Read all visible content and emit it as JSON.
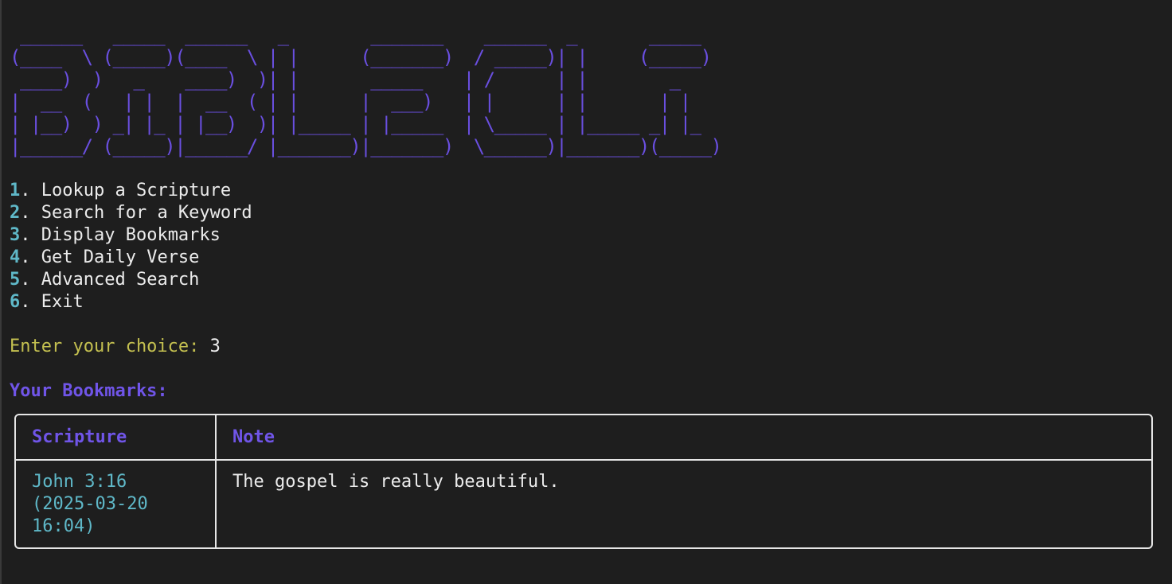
{
  "colors": {
    "background": "#1e1e1e",
    "banner": "#6a4fe0",
    "menu_number": "#5fb8c8",
    "text": "#ececec",
    "prompt": "#c4c050",
    "heading": "#7055e8",
    "scripture": "#5fb8c8",
    "border": "#e6e6e6"
  },
  "banner_lines": [
    " ______   _____  ______   _        _______    ______  _       _____ ",
    "(____  \\ (_____)(____  \\ | |      (_______)  / _____)| |     (_____)",
    " ____)  )   _    ____)  )| |       _____    | /      | |        _   ",
    "|  __  (   | |  |  __  ( | |      |  ___)   | |      | |       | |  ",
    "| |__)  ) _| |_ | |__)  )| |_____ | |_____  | \\_____ | |_____ _| |_ ",
    "|______/ (_____)|______/ |_______)|_______)  \\______)|_______)(_____)"
  ],
  "menu": [
    {
      "num": "1",
      "label": "Lookup a Scripture"
    },
    {
      "num": "2",
      "label": "Search for a Keyword"
    },
    {
      "num": "3",
      "label": "Display Bookmarks"
    },
    {
      "num": "4",
      "label": "Get Daily Verse"
    },
    {
      "num": "5",
      "label": "Advanced Search"
    },
    {
      "num": "6",
      "label": "Exit"
    }
  ],
  "prompt": {
    "label": "Enter your choice: ",
    "value": "3"
  },
  "bookmarks": {
    "heading": "Your Bookmarks:",
    "columns": [
      "Scripture",
      "Note"
    ],
    "rows": [
      {
        "scripture": "John 3:16\n(2025-03-20\n16:04)",
        "note": "The gospel is really beautiful."
      }
    ]
  }
}
